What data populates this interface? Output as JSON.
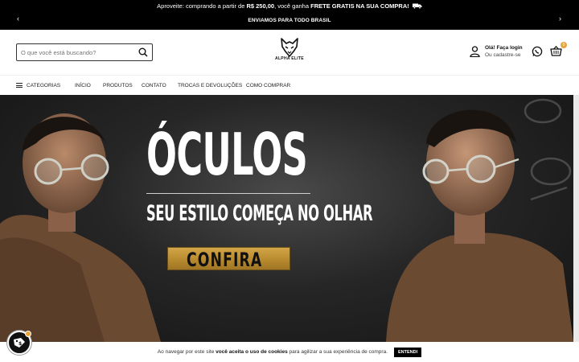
{
  "promo": {
    "line1_pre": "Aproveite: comprando a partir de ",
    "line1_amount": "R$ 250,00",
    "line1_mid": ", você ganha ",
    "line1_bold": "FRETE GRATIS NA SUA COMPRA!",
    "line1_icon": "truck-icon",
    "line2": "ENVIAMOS PARA TODO BRASIL",
    "prev": "‹",
    "next": "›"
  },
  "header": {
    "search_placeholder": "O que você está buscando?",
    "logo_text": "ALPHA ELITE",
    "account_line1": "Olá! Faça login",
    "account_line2": "Ou cadastre-se",
    "cart_count": "0"
  },
  "nav": {
    "categories": "CATEGORIAS",
    "items": [
      "INÍCIO",
      "PRODUTOS",
      "CONTATO",
      "TROCAS E DEVOLUÇÕES",
      "COMO COMPRAR"
    ]
  },
  "hero": {
    "title": "ÓCULOS",
    "subtitle": "SEU ESTILO COMEÇA NO OLHAR",
    "cta": "CONFIRA"
  },
  "cookie": {
    "pre": "Ao navegar por este site ",
    "bold": "você aceita o uso de cookies",
    "post": " para agilizar a sua experiência de compra.",
    "button": "ENTENDI"
  },
  "colors": {
    "accent_gold": "#c49a3c",
    "badge_orange": "#e8a33a"
  }
}
